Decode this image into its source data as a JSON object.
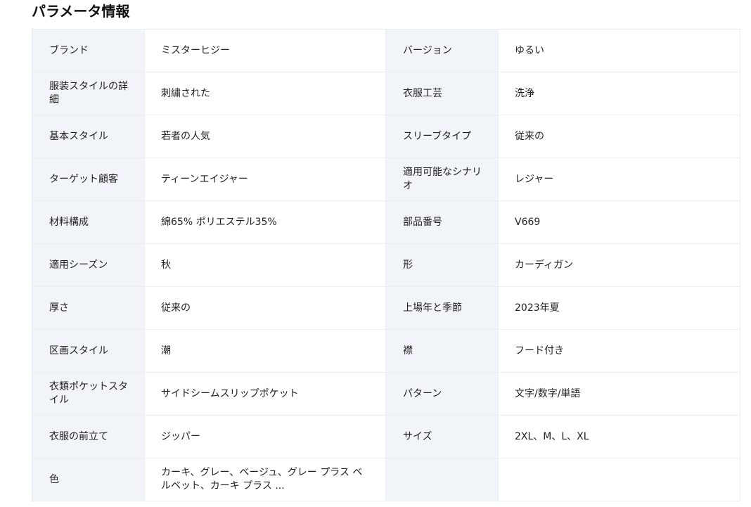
{
  "section_title": "パラメータ情報",
  "rows": [
    {
      "k1": "ブランド",
      "v1": "ミスターヒジー",
      "k2": "バージョン",
      "v2": "ゆるい"
    },
    {
      "k1": "服装スタイルの詳細",
      "v1": "刺繍された",
      "k2": "衣服工芸",
      "v2": "洗浄"
    },
    {
      "k1": "基本スタイル",
      "v1": "若者の人気",
      "k2": "スリーブタイプ",
      "v2": "従来の"
    },
    {
      "k1": "ターゲット顧客",
      "v1": "ティーンエイジャー",
      "k2": "適用可能なシナリオ",
      "v2": "レジャー"
    },
    {
      "k1": "材料構成",
      "v1": "綿65% ポリエステル35%",
      "k2": "部品番号",
      "v2": "V669"
    },
    {
      "k1": "適用シーズン",
      "v1": "秋",
      "k2": "形",
      "v2": "カーディガン"
    },
    {
      "k1": "厚さ",
      "v1": "従来の",
      "k2": "上場年と季節",
      "v2": "2023年夏"
    },
    {
      "k1": "区画スタイル",
      "v1": "潮",
      "k2": "襟",
      "v2": "フード付き"
    },
    {
      "k1": "衣類ポケットスタイル",
      "v1": "サイドシームスリップポケット",
      "k2": "パターン",
      "v2": "文字/数字/単語"
    },
    {
      "k1": "衣服の前立て",
      "v1": "ジッパー",
      "k2": "サイズ",
      "v2": "2XL、M、L、XL"
    },
    {
      "k1": "色",
      "v1": "カーキ、グレー、ベージュ、グレー プラス ベルベット、カーキ プラス ...",
      "k2": "",
      "v2": ""
    }
  ]
}
